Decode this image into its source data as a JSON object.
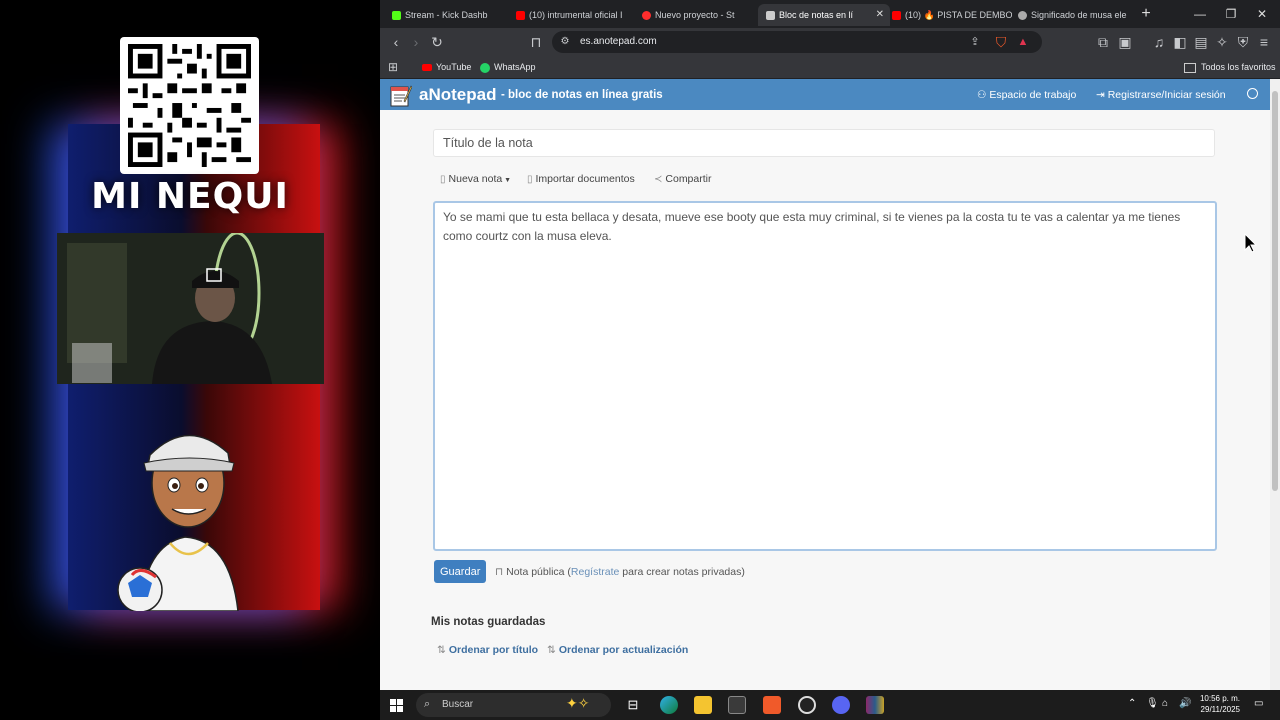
{
  "overlay": {
    "nequi_label": "MI NEQUI"
  },
  "browser": {
    "tabs": [
      {
        "label": "Stream - Kick Dashb",
        "favicon_color": "#53fc18"
      },
      {
        "label": "(10) intrumental oficial I",
        "favicon_color": "#ff0000"
      },
      {
        "label": "Nuevo proyecto - St",
        "favicon_color": "#ff2d2d"
      },
      {
        "label": "Bloc de notas en lí",
        "favicon_color": "#cccccc"
      },
      {
        "label": "(10) 🔥 PISTA DE DEMBO",
        "favicon_color": "#ff0000"
      },
      {
        "label": "Significado de musa ele",
        "favicon_color": "#aaaaaa"
      }
    ],
    "url": "es.anotepad.com",
    "bookmarks": [
      {
        "label": "YouTube"
      },
      {
        "label": "WhatsApp"
      }
    ],
    "favorites_label": "Todos los favoritos"
  },
  "site": {
    "brand": "aNotepad",
    "tagline": "- bloc de notas en línea gratis",
    "workspace_label": "Espacio de trabajo",
    "login_label": "Registrarse/Iniciar sesión",
    "title_placeholder": "Título de la nota",
    "actions": {
      "new_note": "Nueva nota",
      "import_docs": "Importar documentos",
      "share": "Compartir"
    },
    "note_text": "Yo se mami que tu esta bellaca y desata, mueve ese booty que esta muy criminal, si te vienes pa la costa tu te vas a calentar ya me tienes como courtz con la musa eleva.",
    "save_label": "Guardar",
    "public_note_prefix": "Nota pública (",
    "public_note_link": "Regístrate",
    "public_note_suffix": " para crear notas privadas)",
    "saved_heading": "Mis notas guardadas",
    "sort_title": "Ordenar por título",
    "sort_update": "Ordenar por actualización"
  },
  "taskbar": {
    "search_placeholder": "Buscar",
    "time": "10:56 p. m.",
    "date": "29/11/2025"
  }
}
